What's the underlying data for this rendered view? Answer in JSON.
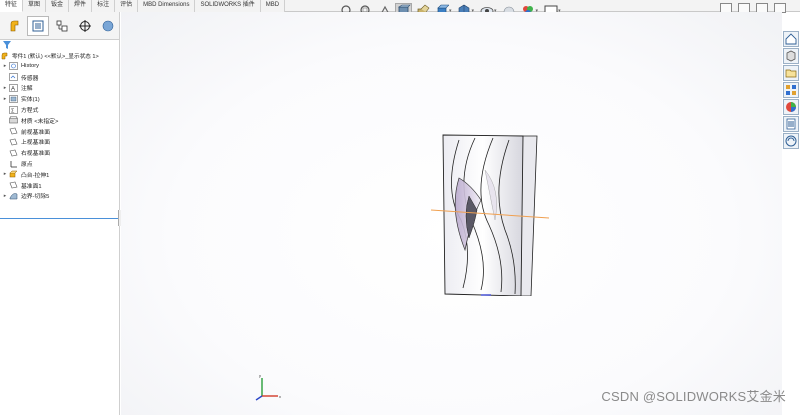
{
  "tabs": [
    {
      "label": "特征",
      "active": true
    },
    {
      "label": "草图"
    },
    {
      "label": "钣金"
    },
    {
      "label": "焊件"
    },
    {
      "label": "标注"
    },
    {
      "label": "评估"
    },
    {
      "label": "MBD Dimensions"
    },
    {
      "label": "SOLIDWORKS 插件"
    },
    {
      "label": "MBD"
    }
  ],
  "feature_manager": {
    "root_label": "零件1 (默认) <<默认>_显示状态 1>",
    "items": [
      {
        "label": "History",
        "icon": "history-icon",
        "expandable": true
      },
      {
        "label": "传感器",
        "icon": "sensor-icon",
        "expandable": false
      },
      {
        "label": "注解",
        "icon": "annotations-icon",
        "expandable": true
      },
      {
        "label": "实体(1)",
        "icon": "solid-bodies-icon",
        "expandable": true
      },
      {
        "label": "方程式",
        "icon": "equations-icon",
        "expandable": false
      },
      {
        "label": "材质 <未指定>",
        "icon": "material-icon",
        "expandable": false
      },
      {
        "label": "前视基准面",
        "icon": "plane-icon",
        "expandable": false
      },
      {
        "label": "上视基准面",
        "icon": "plane-icon",
        "expandable": false
      },
      {
        "label": "右视基准面",
        "icon": "plane-icon",
        "expandable": false
      },
      {
        "label": "原点",
        "icon": "origin-icon",
        "expandable": false
      },
      {
        "label": "凸台-拉伸1",
        "icon": "extrude-icon",
        "expandable": true
      },
      {
        "label": "基准面1",
        "icon": "plane-icon",
        "expandable": false
      },
      {
        "label": "边界-切除5",
        "icon": "boundary-cut-icon",
        "expandable": true
      }
    ]
  },
  "hud_icons": [
    "zoom-to-fit-icon",
    "zoom-to-area-icon",
    "previous-view-icon",
    "section-view-icon",
    "dynamic-annotation-icon",
    "view-orientation-icon",
    "display-style-icon",
    "hide-show-icon",
    "edit-appearance-icon",
    "apply-scene-icon",
    "view-settings-icon"
  ],
  "taskpane_icons": [
    "solidworks-resources-icon",
    "design-library-icon",
    "file-explorer-icon",
    "view-palette-icon",
    "appearances-icon",
    "custom-properties-icon",
    "forum-icon"
  ],
  "watermark": "CSDN @SOLIDWORKS艾金米",
  "colors": {
    "accent": "#4a90d9",
    "selection_line": "#f0a050"
  }
}
